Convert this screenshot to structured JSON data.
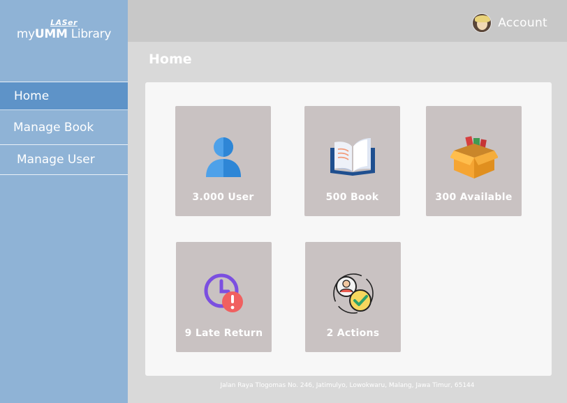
{
  "brand": {
    "sub": "LASer",
    "main_prefix": "my",
    "main_bold": "UMM",
    "main_suffix": " Library"
  },
  "sidebar": {
    "items": [
      {
        "label": "Home",
        "active": true
      },
      {
        "label": "Manage Book",
        "active": false
      },
      {
        "label": "Manage User",
        "active": false
      }
    ]
  },
  "header": {
    "account_label": "Account"
  },
  "page": {
    "title": "Home"
  },
  "stats": [
    {
      "label": "3.000 User",
      "icon": "user-icon"
    },
    {
      "label": "500 Book",
      "icon": "book-icon"
    },
    {
      "label": "300 Available",
      "icon": "box-icon"
    },
    {
      "label": "9 Late Return",
      "icon": "late-clock-icon"
    },
    {
      "label": "2 Actions",
      "icon": "actions-check-icon"
    }
  ],
  "footer": {
    "address": "Jalan Raya Tlogomas No. 246, Jatimulyo, Lowokwaru, Malang, Jawa Timur, 65144"
  },
  "colors": {
    "sidebar": "#8fb3d6",
    "sidebar_active": "#5e93c8",
    "card": "#c9c2c2",
    "background": "#d9d9d9",
    "panel": "#f7f7f7"
  }
}
